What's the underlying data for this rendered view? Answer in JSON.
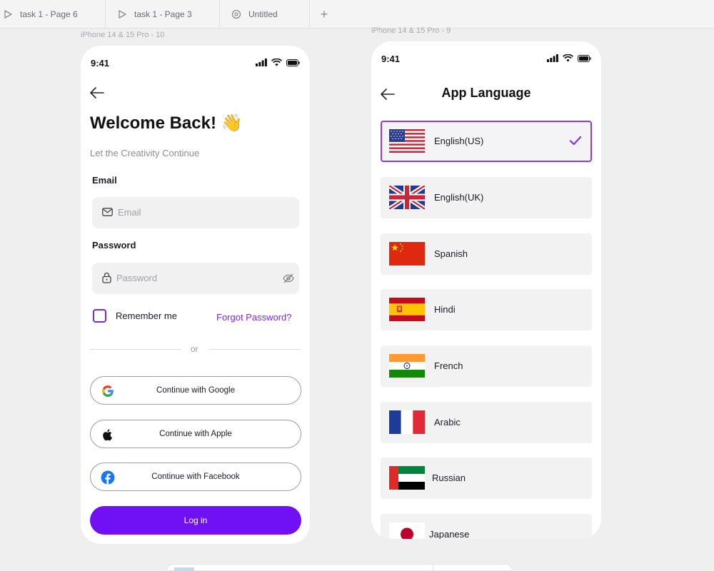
{
  "tabs": [
    {
      "label": "task 1 - Page 6",
      "icon": "play-icon"
    },
    {
      "label": "task 1 - Page 3",
      "icon": "play-icon"
    },
    {
      "label": "Untitled",
      "icon": "figma-draft-icon"
    }
  ],
  "tab_add": "+",
  "frames": {
    "left_label": "iPhone 14 & 15 Pro - 10",
    "right_label": "iPhone 14 & 15 Pro - 9"
  },
  "login": {
    "time": "9:41",
    "title": "Welcome Back! 👋",
    "subtitle": "Let the Creativity Continue",
    "email_label": "Email",
    "email_placeholder": "Email",
    "password_label": "Password",
    "password_placeholder": "Password",
    "remember_label": "Remember me",
    "forgot_label": "Forgot Password?",
    "or_label": "or",
    "google_label": "Continue with Google",
    "apple_label": "Continue with Apple",
    "facebook_label": "Continue with Facebook",
    "login_label": "Log in"
  },
  "language": {
    "time": "9:41",
    "title": "App Language",
    "items": [
      {
        "name": "English(US)",
        "flag": "us-flag",
        "selected": true
      },
      {
        "name": "English(UK)",
        "flag": "uk-flag",
        "selected": false
      },
      {
        "name": "Spanish",
        "flag": "china-flag",
        "selected": false
      },
      {
        "name": "Hindi",
        "flag": "spain-flag",
        "selected": false
      },
      {
        "name": "French",
        "flag": "india-flag",
        "selected": false
      },
      {
        "name": "Arabic",
        "flag": "france-flag",
        "selected": false
      },
      {
        "name": "Russian",
        "flag": "uae-flag",
        "selected": false
      },
      {
        "name": "Japanese",
        "flag": "japan-flag",
        "selected": false
      }
    ]
  },
  "colors": {
    "accent": "#7010f5",
    "accent_text": "#7a2bd9",
    "selected_border": "#8a3ce0",
    "canvas": "#efeff0"
  }
}
